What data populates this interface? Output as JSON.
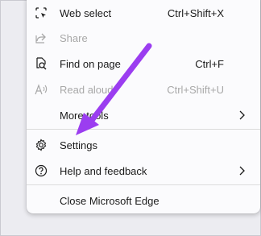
{
  "menu": {
    "items": [
      {
        "label": "Web select",
        "shortcut": "Ctrl+Shift+X",
        "icon": "web-select-icon",
        "enabled": true
      },
      {
        "label": "Share",
        "shortcut": "",
        "icon": "share-icon",
        "enabled": false
      },
      {
        "label": "Find on page",
        "shortcut": "Ctrl+F",
        "icon": "find-icon",
        "enabled": true
      },
      {
        "label": "Read aloud",
        "shortcut": "Ctrl+Shift+U",
        "icon": "read-aloud-icon",
        "enabled": false
      },
      {
        "label": "More tools",
        "shortcut": "",
        "icon": "",
        "enabled": true,
        "submenu": true
      },
      {
        "label": "Settings",
        "shortcut": "",
        "icon": "gear-icon",
        "enabled": true
      },
      {
        "label": "Help and feedback",
        "shortcut": "",
        "icon": "help-icon",
        "enabled": true,
        "submenu": true
      },
      {
        "label": "Close Microsoft Edge",
        "shortcut": "",
        "icon": "",
        "enabled": true
      }
    ]
  },
  "colors": {
    "annotation_arrow": "#9b3df0",
    "disabled_text": "#a8a8a8",
    "text": "#1b1b1b"
  }
}
